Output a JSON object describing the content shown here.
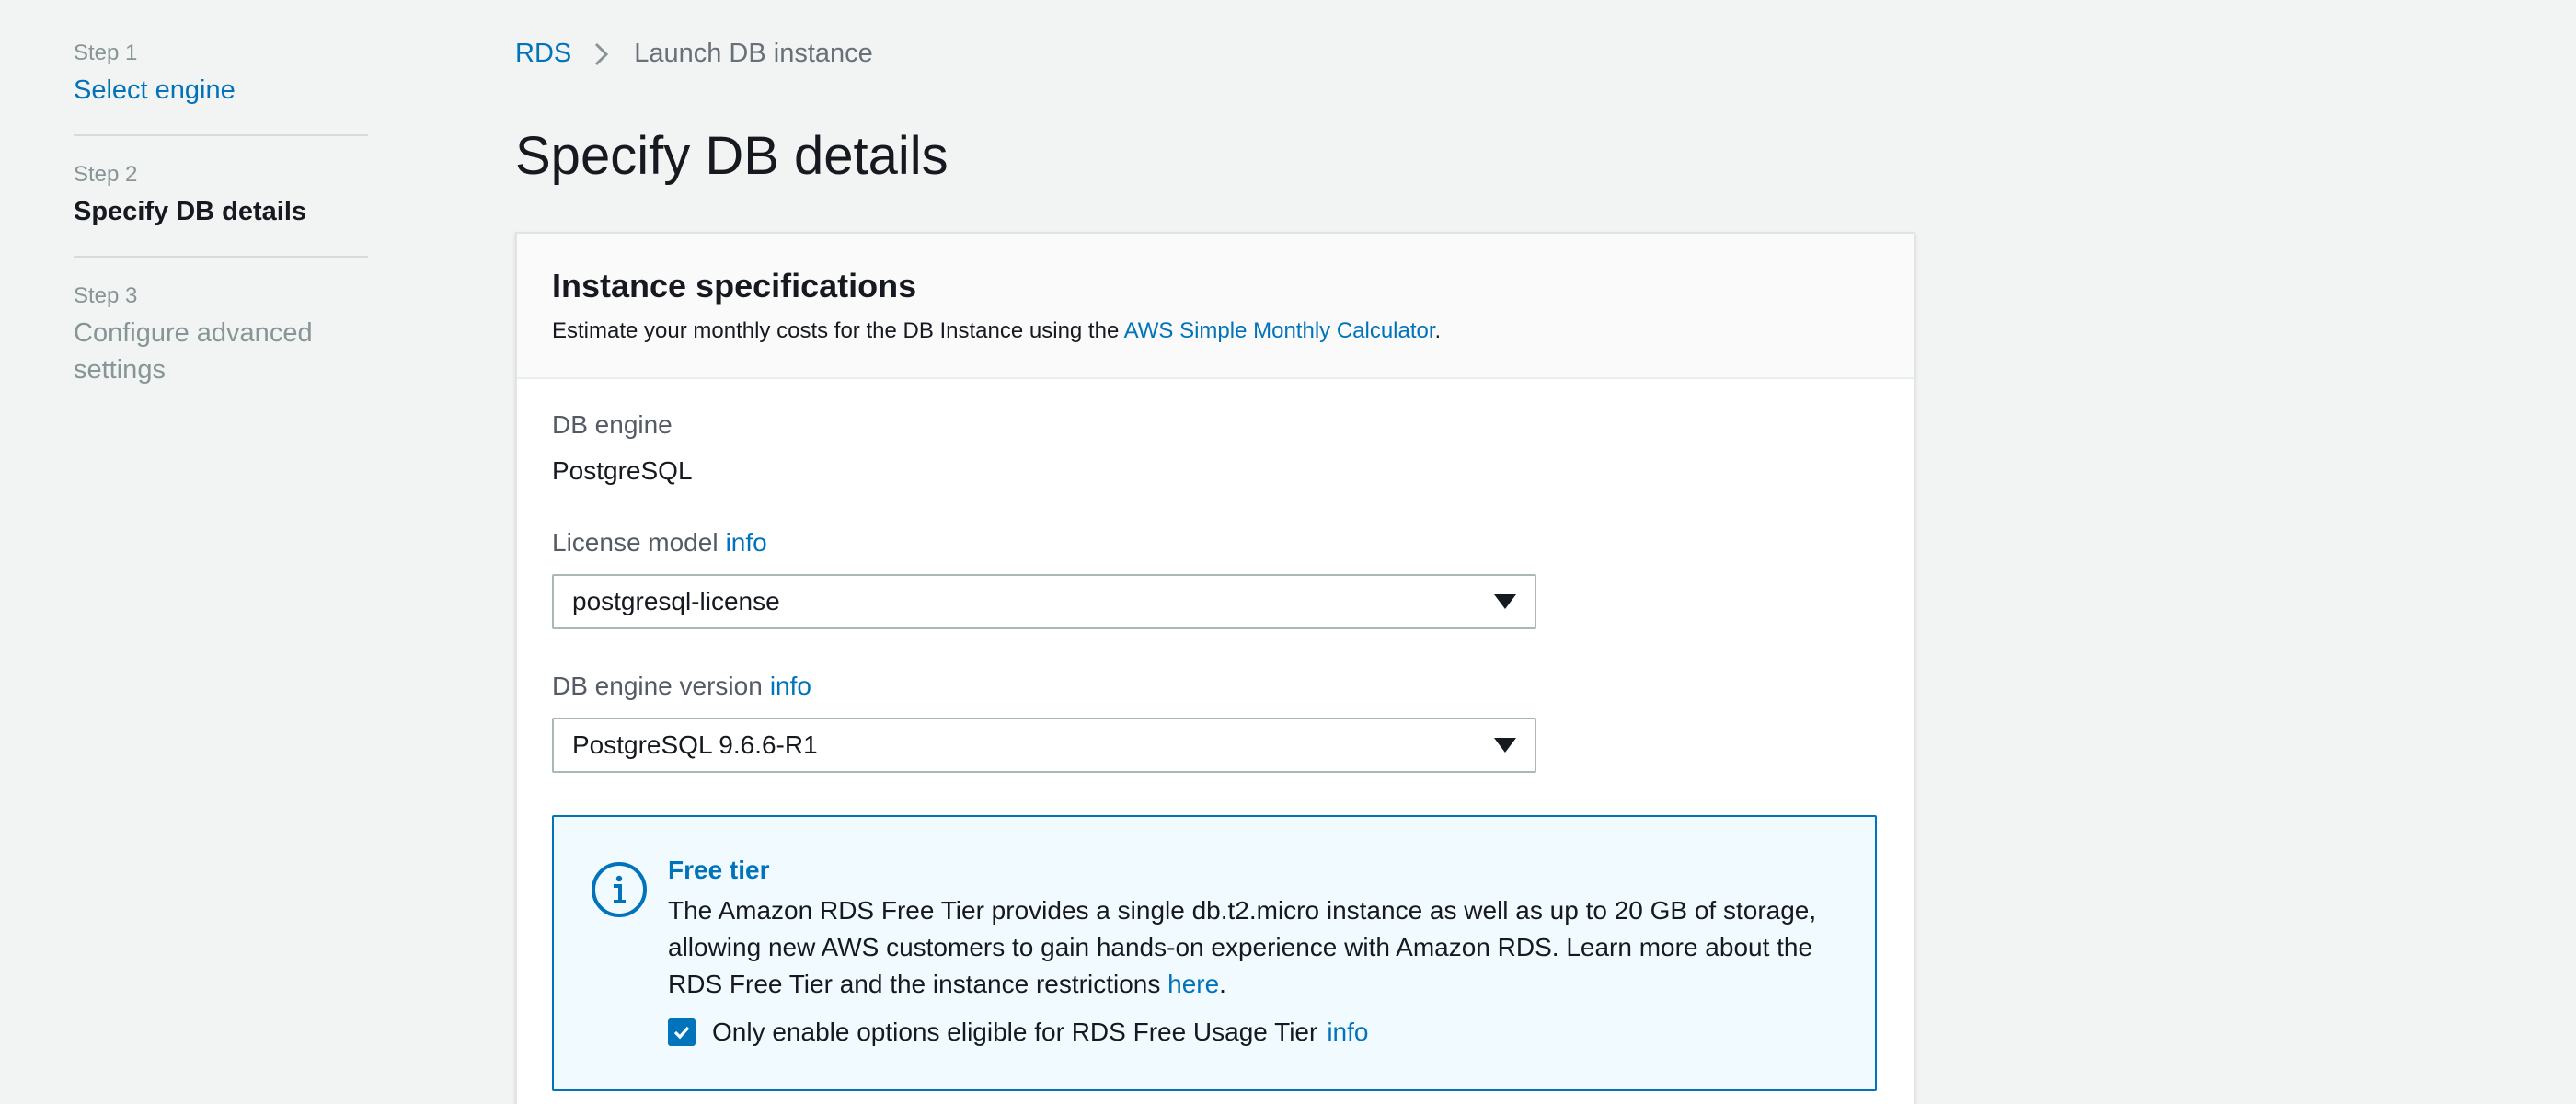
{
  "steps": [
    {
      "number": "Step 1",
      "label": "Select engine"
    },
    {
      "number": "Step 2",
      "label": "Specify DB details"
    },
    {
      "number": "Step 3",
      "label": "Configure advanced settings"
    }
  ],
  "breadcrumb": {
    "root": "RDS",
    "current": "Launch DB instance"
  },
  "page_title": "Specify DB details",
  "panel": {
    "title": "Instance specifications",
    "desc_prefix": "Estimate your monthly costs for the DB Instance using the ",
    "desc_link": "AWS Simple Monthly Calculator",
    "desc_suffix": "."
  },
  "fields": {
    "db_engine": {
      "label": "DB engine",
      "value": "PostgreSQL"
    },
    "license_model": {
      "label": "License model",
      "info": "info",
      "value": "postgresql-license"
    },
    "engine_version": {
      "label": "DB engine version",
      "info": "info",
      "value": "PostgreSQL 9.6.6-R1"
    }
  },
  "free_tier": {
    "title": "Free tier",
    "text": "The Amazon RDS Free Tier provides a single db.t2.micro instance as well as up to 20 GB of storage, allowing new AWS customers to gain hands-on experience with Amazon RDS. Learn more about the RDS Free Tier and the instance restrictions ",
    "link": "here",
    "text_suffix": ".",
    "checkbox_label": "Only enable options eligible for RDS Free Usage Tier",
    "checkbox_info": "info",
    "checkbox_checked": true
  },
  "colors": {
    "accent": "#0073bb",
    "background": "#f2f3f3",
    "alert_bg": "#f1faff"
  },
  "icons": [
    "chevron-right-icon",
    "caret-down-icon",
    "info-circle-icon",
    "check-icon"
  ]
}
